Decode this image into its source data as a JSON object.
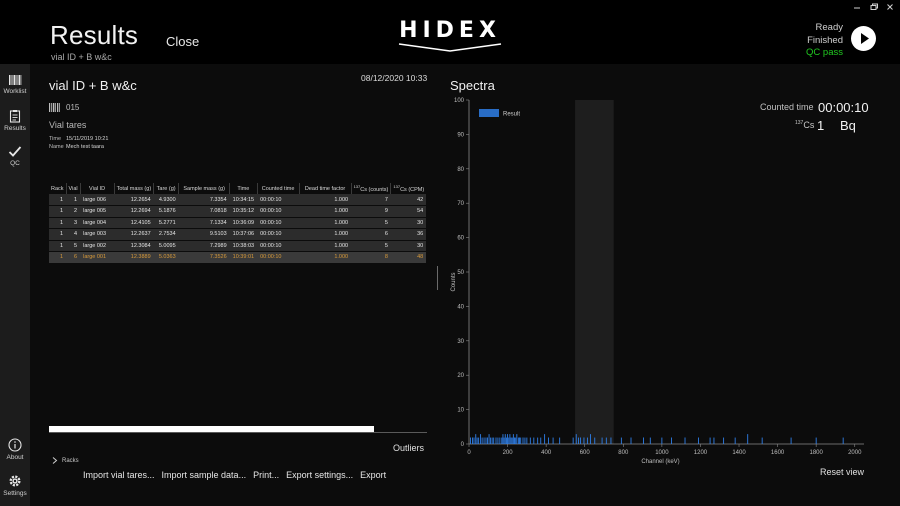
{
  "header": {
    "title": "Results",
    "subtitle": "vial ID + B w&c",
    "close_label": "Close",
    "logo_text": "HIDEX",
    "status": {
      "ready": "Ready",
      "finished": "Finished",
      "qc": "QC pass"
    }
  },
  "sidebar": {
    "items": [
      {
        "label": "Worklist",
        "icon": "barcode-icon"
      },
      {
        "label": "Results",
        "icon": "clipboard-icon"
      },
      {
        "label": "QC",
        "icon": "checkmark-icon"
      },
      {
        "label": "About",
        "icon": "info-icon"
      },
      {
        "label": "Settings",
        "icon": "gear-icon"
      }
    ]
  },
  "left": {
    "vial_title": "vial ID + B w&c",
    "date": "08/12/2020 10:33",
    "barcode": "015",
    "tares_label": "Vial tares",
    "meta": {
      "time_key": "Time",
      "time_value": "15/11/2019 10:21",
      "name_key": "Name",
      "name_value": "Mech test taara"
    },
    "table": {
      "headers": [
        "Rack",
        "Vial",
        "Vial ID",
        "Total mass (g)",
        "Tare (g)",
        "Sample mass (g)",
        "Time",
        "Counted time",
        "Dead time factor",
        "Cs (counts)",
        "Cs (CPM)"
      ],
      "iso_sup": "137",
      "rows": [
        [
          "1",
          "1",
          "large 006",
          "12.2654",
          "4.9300",
          "7.3354",
          "10:34:15",
          "00:00:10",
          "1.000",
          "7",
          "42"
        ],
        [
          "1",
          "2",
          "large 005",
          "12.2694",
          "5.1876",
          "7.0818",
          "10:35:12",
          "00:00:10",
          "1.000",
          "9",
          "54"
        ],
        [
          "1",
          "3",
          "large 004",
          "12.4105",
          "5.2771",
          "7.1334",
          "10:36:09",
          "00:00:10",
          "1.000",
          "5",
          "30"
        ],
        [
          "1",
          "4",
          "large 003",
          "12.2637",
          "2.7534",
          "9.5103",
          "10:37:06",
          "00:00:10",
          "1.000",
          "6",
          "36"
        ],
        [
          "1",
          "5",
          "large 002",
          "12.3084",
          "5.0095",
          "7.2989",
          "10:38:03",
          "00:00:10",
          "1.000",
          "5",
          "30"
        ],
        [
          "1",
          "6",
          "large 001",
          "12.3889",
          "5.0363",
          "7.3526",
          "10:39:01",
          "00:00:10",
          "1.000",
          "8",
          "48"
        ]
      ],
      "selected_row": 5
    },
    "progress": 0.86,
    "outliers_label": "Outliers",
    "racks_label": "Racks",
    "actions": [
      "Import vial tares...",
      "Import sample data...",
      "Print...",
      "Export settings...",
      "Export"
    ]
  },
  "right": {
    "title": "Spectra",
    "counted_time_label": "Counted time",
    "counted_time_value": "00:00:10",
    "cs_sup": "137",
    "cs_label": "Cs",
    "cs_value": "1",
    "cs_unit": "Bq",
    "reset_view_label": "Reset view"
  },
  "chart_data": {
    "type": "bar",
    "xlabel": "Channel (keV)",
    "ylabel": "Counts",
    "xlim": [
      0,
      2048
    ],
    "ylim": [
      0,
      100
    ],
    "xticks": [
      0,
      200,
      400,
      600,
      800,
      1000,
      1200,
      1400,
      1600,
      1800,
      2000
    ],
    "yticks": [
      0,
      10,
      20,
      30,
      40,
      50,
      60,
      70,
      80,
      90,
      100
    ],
    "grid": false,
    "legend": {
      "entries": [
        "Result"
      ],
      "position": "top-left"
    },
    "highlight_region": [
      550,
      750
    ],
    "series": [
      {
        "name": "Result",
        "color": "#2f7fe8",
        "x": [
          8,
          18,
          26,
          35,
          42,
          50,
          60,
          68,
          78,
          88,
          96,
          104,
          112,
          120,
          128,
          140,
          150,
          160,
          170,
          176,
          182,
          188,
          194,
          200,
          206,
          212,
          218,
          224,
          230,
          236,
          242,
          248,
          256,
          262,
          268,
          280,
          290,
          300,
          318,
          336,
          356,
          372,
          392,
          412,
          436,
          470,
          540,
          556,
          568,
          578,
          596,
          614,
          630,
          652,
          690,
          712,
          736,
          790,
          840,
          905,
          940,
          1000,
          1050,
          1120,
          1190,
          1250,
          1270,
          1320,
          1380,
          1445,
          1520,
          1670,
          1800,
          1940
        ],
        "values": [
          1,
          1,
          1,
          2,
          1,
          1,
          2,
          1,
          1,
          1,
          1,
          2,
          1,
          1,
          1,
          1,
          1,
          1,
          1,
          2,
          1,
          2,
          1,
          2,
          1,
          2,
          1,
          1,
          2,
          1,
          1,
          2,
          1,
          1,
          1,
          1,
          1,
          1,
          1,
          1,
          1,
          1,
          2,
          1,
          1,
          1,
          1,
          2,
          1,
          1,
          1,
          1,
          2,
          1,
          1,
          1,
          1,
          1,
          1,
          1,
          1,
          1,
          1,
          1,
          1,
          1,
          1,
          1,
          1,
          2,
          1,
          1,
          1,
          1
        ]
      }
    ]
  },
  "colors": {
    "accent_qc": "#20c820",
    "selected_row_text": "#d89a3a",
    "series": "#2f7fe8"
  }
}
